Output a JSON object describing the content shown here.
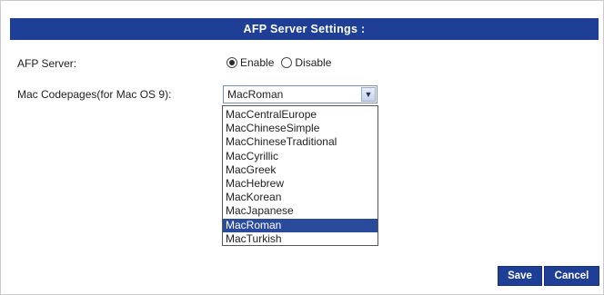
{
  "header": {
    "title": "AFP Server Settings :"
  },
  "afp_server": {
    "label": "AFP Server:",
    "options": [
      {
        "label": "Enable",
        "checked": true
      },
      {
        "label": "Disable",
        "checked": false
      }
    ]
  },
  "codepage": {
    "label": "Mac Codepages(for Mac OS 9):",
    "selected": "MacRoman",
    "options": [
      "MacCentralEurope",
      "MacChineseSimple",
      "MacChineseTraditional",
      "MacCyrillic",
      "MacGreek",
      "MacHebrew",
      "MacKorean",
      "MacJapanese",
      "MacRoman",
      "MacTurkish"
    ]
  },
  "buttons": {
    "save": "Save",
    "cancel": "Cancel"
  },
  "colors": {
    "accent": "#1f3f96",
    "highlight": "#2a4b9b"
  },
  "icons": {
    "dropdown": "chevron-down-icon"
  }
}
